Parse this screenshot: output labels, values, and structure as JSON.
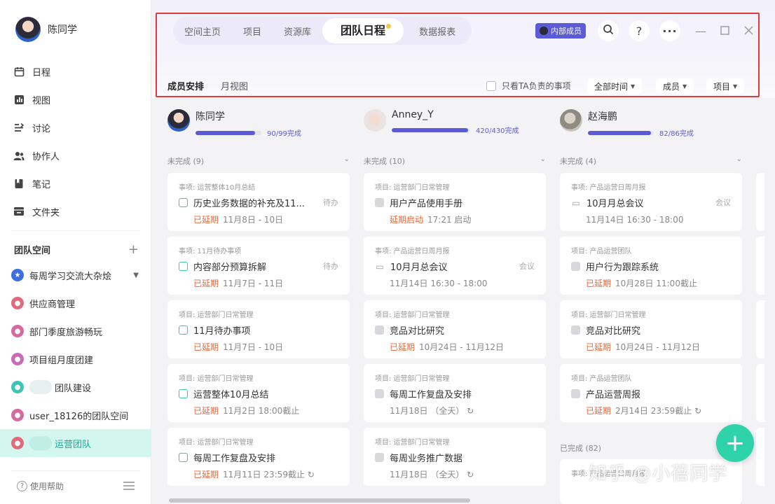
{
  "user": {
    "name": "陈同学"
  },
  "nav": [
    {
      "label": "日程",
      "icon": "calendar-icon"
    },
    {
      "label": "视图",
      "icon": "chart-icon"
    },
    {
      "label": "讨论",
      "icon": "discussion-icon"
    },
    {
      "label": "协作人",
      "icon": "people-icon"
    },
    {
      "label": "笔记",
      "icon": "note-icon"
    },
    {
      "label": "文件夹",
      "icon": "folder-icon"
    }
  ],
  "team_section": {
    "title": "团队空间",
    "add": "+"
  },
  "spaces": [
    {
      "label": "每周学习交流大杂烩",
      "color": "#3a6fe0"
    },
    {
      "label": "供应商管理",
      "color": "#e06a7a"
    },
    {
      "label": "部门季度旅游畅玩",
      "color": "#d66aa0"
    },
    {
      "label": "项目组月度团建",
      "color": "#c96ab8"
    },
    {
      "label": "团队建设",
      "color": "#3cc4b4"
    },
    {
      "label": "user_18126的团队空间",
      "color": "#d66aa0"
    },
    {
      "label": "运营团队",
      "color": "#e06a7a"
    }
  ],
  "help": "使用帮助",
  "tabs": [
    "空间主页",
    "项目",
    "资源库",
    "团队日程",
    "数据报表"
  ],
  "active_tab": "团队日程",
  "member_badge": "内部成员",
  "subtabs": [
    "成员安排",
    "月视图"
  ],
  "filters": {
    "only_mine": "只看TA负责的事项",
    "time": "全部时间",
    "member": "成员",
    "project": "项目"
  },
  "columns": [
    {
      "name": "陈同学",
      "progress": "90/99完成",
      "fraction": 0.909,
      "group": "未完成 (9)",
      "cards": [
        {
          "meta": "事项: 运营整体10月总结",
          "title": "历史业务数据的补充及11...",
          "tag": "待办",
          "overdue": "已延期",
          "date": "11月8日 - 10日",
          "box": "open"
        },
        {
          "meta": "事项: 11月待办事项",
          "title": "内容部分预算拆解",
          "tag": "待办",
          "overdue": "已延期",
          "date": "11月7日 - 11日",
          "box": "open"
        },
        {
          "meta": "项目: 运营部门日常管理",
          "title": "11月待办事项",
          "tag": "",
          "overdue": "已延期",
          "date": "11月7日 - 10日",
          "box": "open"
        },
        {
          "meta": "项目: 运营部门日常管理",
          "title": "运营整体10月总结",
          "tag": "",
          "overdue": "已延期",
          "date": "11月2日 18:00截止",
          "box": "open"
        },
        {
          "meta": "项目: 运营部门日常管理",
          "title": "每周工作复盘及安排",
          "tag": "",
          "overdue": "已延期",
          "date": "11月11日 23:59截止 ↻",
          "box": "open"
        }
      ]
    },
    {
      "name": "Anney_Y",
      "progress": "420/430完成",
      "fraction": 0.977,
      "group": "未完成 (10)",
      "cards": [
        {
          "meta": "项目: 运营部门日常管理",
          "title": "用户产品使用手册",
          "tag": "",
          "overdue": "延期启动",
          "date": "17:21 启动",
          "box": "grey"
        },
        {
          "meta": "事项: 产品运营日周月报",
          "title": "10月月总会议",
          "tag": "会议",
          "overdue": "",
          "date": "11月14日 16:30 - 18:00",
          "box": "meet"
        },
        {
          "meta": "项目: 运营部门日常管理",
          "title": "竞品对比研究",
          "tag": "",
          "overdue": "已延期",
          "date": "10月24日 - 11月12日",
          "box": "grey"
        },
        {
          "meta": "项目: 运营部门日常管理",
          "title": "每周工作复盘及安排",
          "tag": "",
          "overdue": "",
          "date": "11月18日 （全天） ↻",
          "box": "grey"
        },
        {
          "meta": "项目: 运营部门日常管理",
          "title": "每周业务推广数据",
          "tag": "",
          "overdue": "",
          "date": "11月18日 （全天） ↻",
          "box": "grey"
        }
      ]
    },
    {
      "name": "赵海鹏",
      "progress": "82/86完成",
      "fraction": 0.953,
      "group": "未完成 (4)",
      "cards": [
        {
          "meta": "事项: 产品运营日周月报",
          "title": "10月月总会议",
          "tag": "会议",
          "overdue": "",
          "date": "11月14日 16:30 - 18:00",
          "box": "meet"
        },
        {
          "meta": "项目: 产品运营团队",
          "title": "用户行为跟踪系统",
          "tag": "",
          "overdue": "已延期",
          "date": "10月28日 11:00截止",
          "box": "grey"
        },
        {
          "meta": "项目: 运营部门日常管理",
          "title": "竞品对比研究",
          "tag": "",
          "overdue": "已延期",
          "date": "10月24日 - 11月12日",
          "box": "grey"
        },
        {
          "meta": "项目: 产品运营团队",
          "title": "产品运营周报",
          "tag": "",
          "overdue": "已延期",
          "date": "2月14日 23:59截止 ↻",
          "box": "grey"
        }
      ],
      "done_group": "已完成 (82)",
      "partial_meta": "事项: 产品运营日周月报"
    }
  ],
  "watermark": "知乎 @小蓓同学"
}
